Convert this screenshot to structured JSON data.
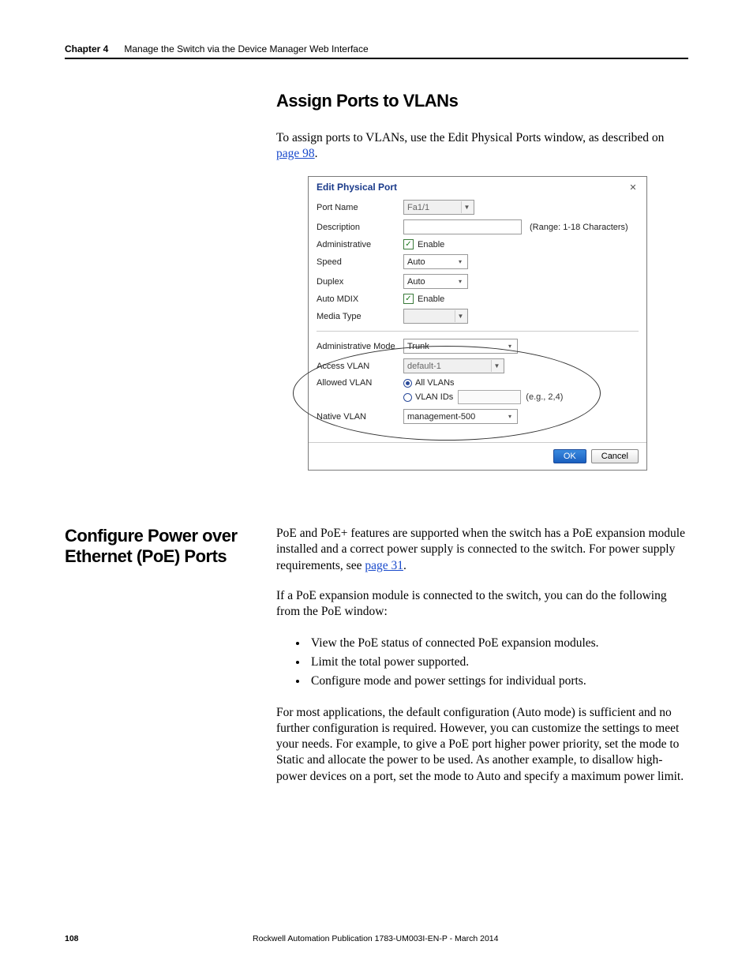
{
  "header": {
    "chapter_label": "Chapter 4",
    "chapter_title": "Manage the Switch via the Device Manager Web Interface"
  },
  "section1": {
    "heading": "Assign Ports to VLANs",
    "intro_pre": "To assign ports to VLANs, use the Edit Physical Ports window, as described on ",
    "intro_link": "page 98",
    "intro_post": "."
  },
  "dialog": {
    "title": "Edit Physical Port",
    "fields": {
      "port_name": {
        "label": "Port Name",
        "value": "Fa1/1"
      },
      "description": {
        "label": "Description",
        "value": "",
        "range": "(Range: 1-18 Characters)"
      },
      "administrative": {
        "label": "Administrative",
        "checkbox_label": "Enable"
      },
      "speed": {
        "label": "Speed",
        "value": "Auto"
      },
      "duplex": {
        "label": "Duplex",
        "value": "Auto"
      },
      "auto_mdix": {
        "label": "Auto MDIX",
        "checkbox_label": "Enable"
      },
      "media_type": {
        "label": "Media Type",
        "value": ""
      },
      "admin_mode": {
        "label": "Administrative Mode",
        "value": "Trunk"
      },
      "access_vlan": {
        "label": "Access VLAN",
        "value": "default-1"
      },
      "allowed_vlan": {
        "label": "Allowed VLAN",
        "opt_all": "All VLANs",
        "opt_ids": "VLAN IDs",
        "eg": "(e.g., 2,4)"
      },
      "native_vlan": {
        "label": "Native VLAN",
        "value": "management-500"
      }
    },
    "buttons": {
      "ok": "OK",
      "cancel": "Cancel"
    }
  },
  "section2": {
    "heading": "Configure Power over Ethernet (PoE) Ports",
    "para1_pre": "PoE and PoE+ features are supported when the switch has a PoE expansion module installed and a correct power supply is connected to the switch. For power supply requirements, see ",
    "para1_link": "page 31",
    "para1_post": ".",
    "para2": "If a PoE expansion module is connected to the switch, you can do the following from the PoE window:",
    "bullets": [
      "View the PoE status of connected PoE expansion modules.",
      "Limit the total power supported.",
      "Configure mode and power settings for individual ports."
    ],
    "para3": "For most applications, the default configuration (Auto mode) is sufficient and no further configuration is required. However, you can customize the settings to meet your needs. For example, to give a PoE port higher power priority, set the mode to Static and allocate the power to be used. As another example, to disallow high-power devices on a port, set the mode to Auto and specify a maximum power limit."
  },
  "footer": {
    "page_num": "108",
    "publication": "Rockwell Automation Publication 1783-UM003I-EN-P - March 2014"
  }
}
